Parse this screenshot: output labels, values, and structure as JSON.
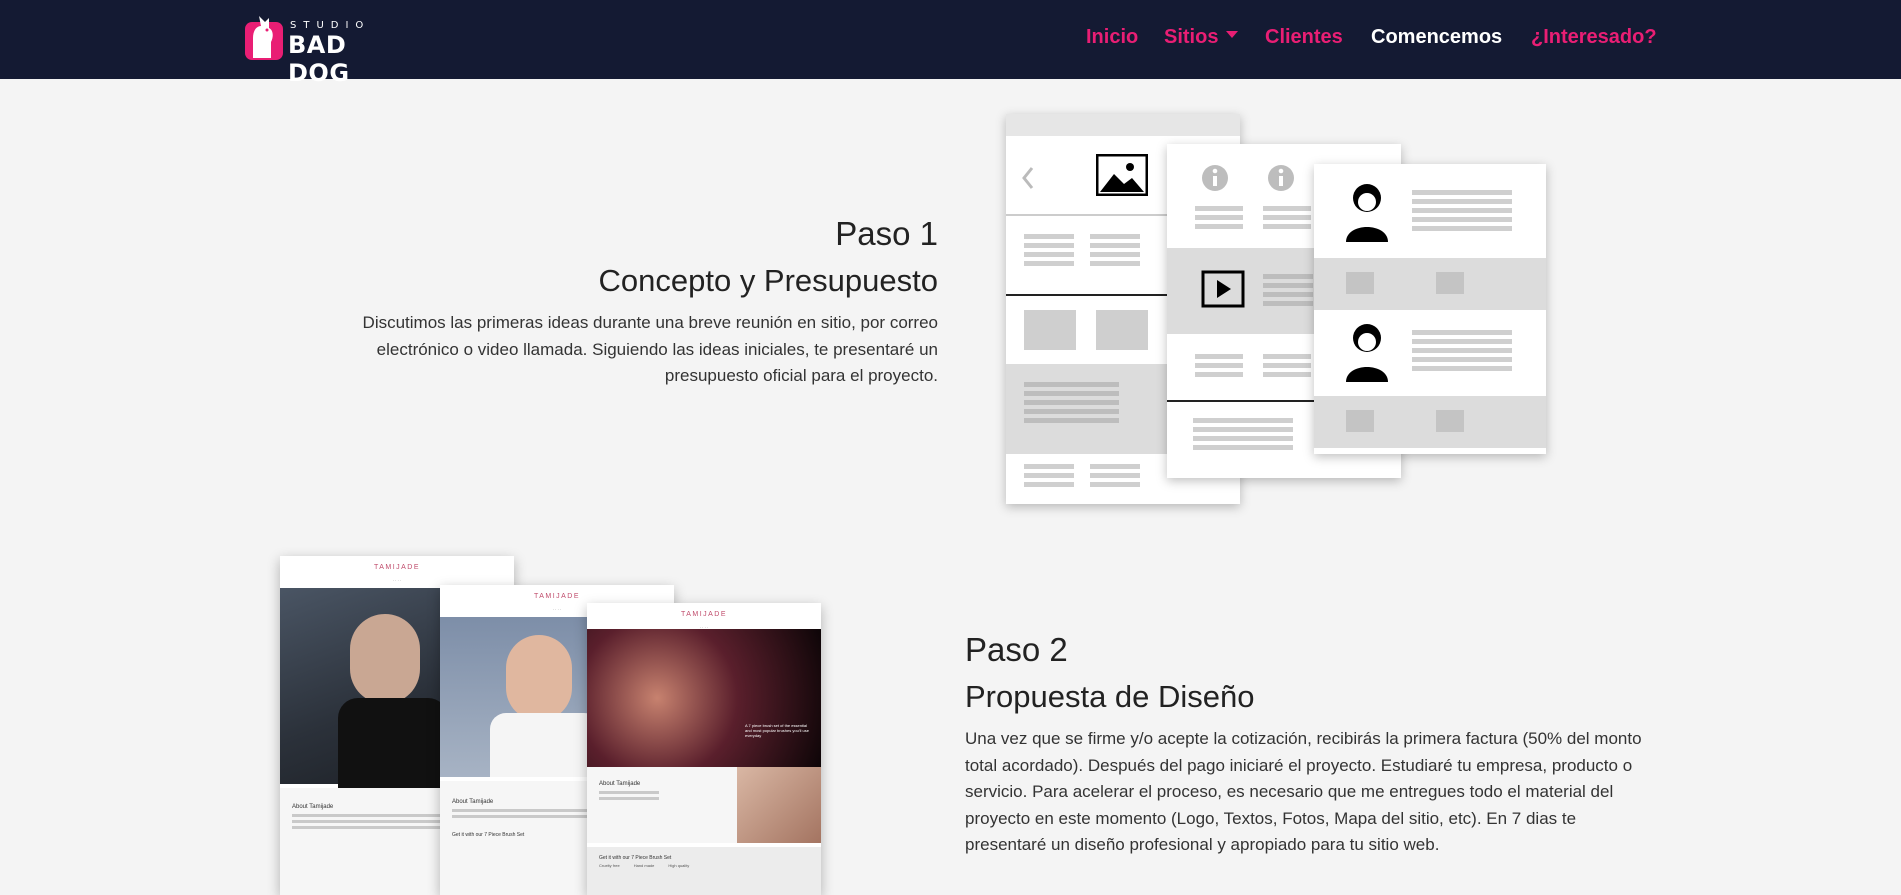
{
  "brand": {
    "studio": "STUDIO",
    "name": "BAD DOG"
  },
  "nav": {
    "items": [
      {
        "label": "Inicio"
      },
      {
        "label": "Sitios"
      },
      {
        "label": "Clientes"
      },
      {
        "label": "Comencemos"
      },
      {
        "label": "¿Interesado?"
      }
    ]
  },
  "colors": {
    "navbar_bg": "#141a33",
    "accent": "#e91e74",
    "page_bg": "#f4f4f4"
  },
  "step1": {
    "title": "Paso 1",
    "subtitle": "Concepto y Presupuesto",
    "description": "Discutimos las primeras ideas durante una breve reunión en sitio, por correo electrónico o video llamada. Siguiendo las ideas iniciales, te presentaré un presupuesto oficial para el proyecto."
  },
  "step2": {
    "title": "Paso 2",
    "subtitle": "Propuesta de Diseño",
    "description": "Una vez que se firme y/o acepte la cotización, recibirás la primera factura (50% del monto total acordado). Después del pago iniciaré el proyecto. Estudiaré tu empresa, producto o servicio. Para acelerar el proceso, es necesario que me entregues todo el material del proyecto en este momento (Logo, Textos, Fotos, Mapa del sitio, etc). En 7 dias te presentaré un diseño profesional y apropiado para tu sitio web."
  },
  "mockups": {
    "brand": "TAMIJADE",
    "about": "About Tamijade",
    "cta": "Get it with our 7 Piece Brush Set",
    "promo": "A 7 piece brush set of the essential and most popular brushes you'll use everyday",
    "cols": [
      "Cruelty free",
      "Hand made",
      "High quality"
    ]
  }
}
